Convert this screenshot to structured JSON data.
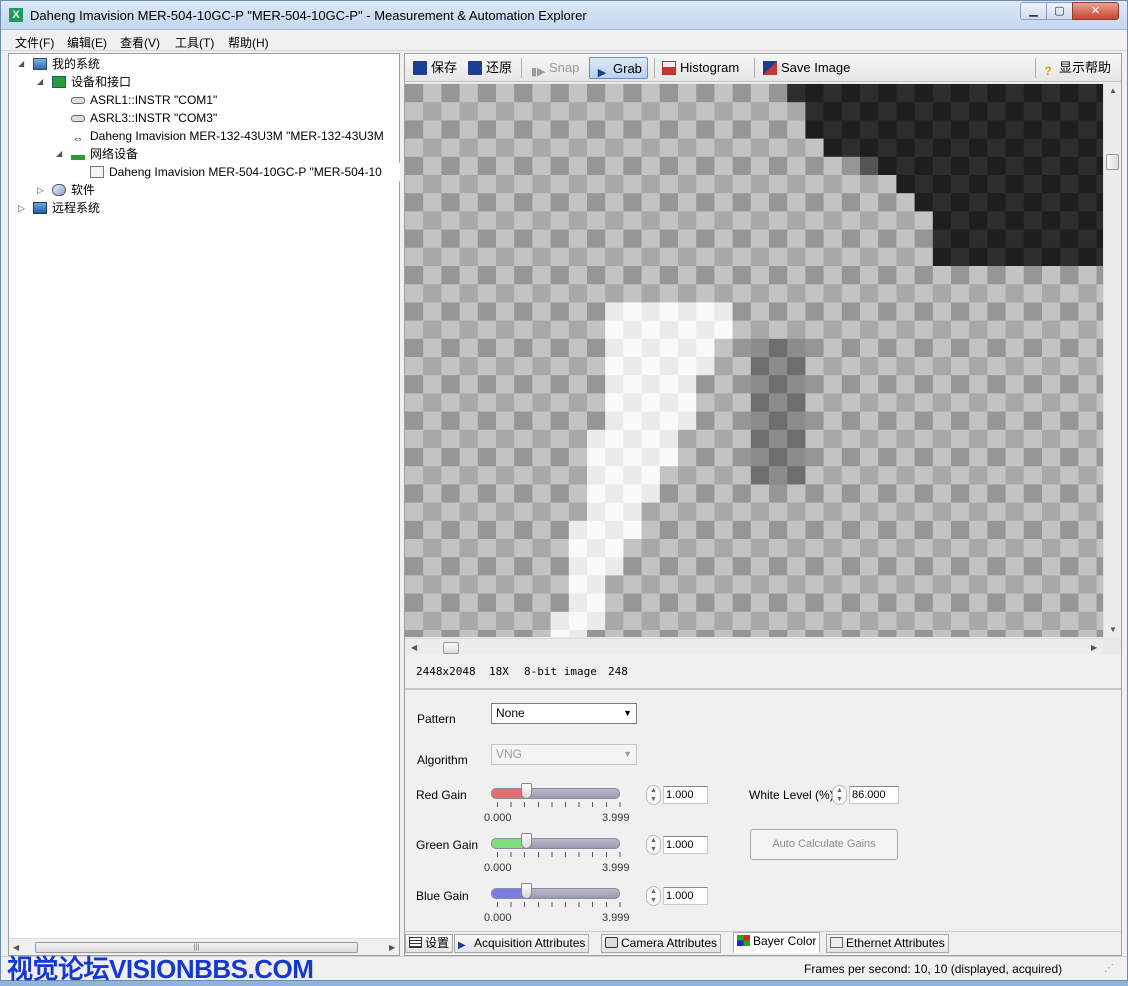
{
  "window": {
    "title": "Daheng Imavision MER-504-10GC-P \"MER-504-10GC-P\" - Measurement & Automation Explorer",
    "app_icon": "X",
    "controls": {
      "minimize": "▁",
      "maximize": "▢",
      "close": "✕"
    }
  },
  "menu": [
    "文件(F)",
    "编辑(E)",
    "查看(V)",
    "工具(T)",
    "帮助(H)"
  ],
  "tree": {
    "my_system": "我的系统",
    "devices_interfaces": "设备和接口",
    "asrl1": "ASRL1::INSTR \"COM1\"",
    "asrl3": "ASRL3::INSTR \"COM3\"",
    "usb_camera": "Daheng Imavision MER-132-43U3M \"MER-132-43U3M",
    "network_devices": "网络设备",
    "gige_camera": "Daheng Imavision MER-504-10GC-P \"MER-504-10",
    "software": "软件",
    "remote_systems": "远程系统"
  },
  "toolbar": {
    "save": "保存",
    "revert": "还原",
    "snap": "Snap",
    "grab": "Grab",
    "histogram": "Histogram",
    "save_image": "Save Image",
    "show_help": "显示帮助"
  },
  "image_status": {
    "resolution": "2448x2048",
    "zoom": "18X",
    "bit_depth": "8-bit image",
    "pixel_value": "248"
  },
  "bayer": {
    "pattern_label": "Pattern",
    "pattern_value": "None",
    "algorithm_label": "Algorithm",
    "algorithm_value": "VNG",
    "red_gain_label": "Red Gain",
    "red_gain_value": "1.000",
    "green_gain_label": "Green Gain",
    "green_gain_value": "1.000",
    "blue_gain_label": "Blue Gain",
    "blue_gain_value": "1.000",
    "slider_min": "0.000",
    "slider_max": "3.999",
    "gain_level_fraction": 0.25,
    "white_level_label": "White Level (%)",
    "white_level_value": "86.000",
    "auto_calc": "Auto Calculate Gains",
    "colors": {
      "red": "#e07070",
      "green": "#7ee07e",
      "blue": "#7b7be0"
    }
  },
  "tabs": [
    "设置",
    "Acquisition Attributes",
    "Camera Attributes",
    "Bayer Color",
    "Ethernet Attributes"
  ],
  "statusbar": {
    "watermark": "视觉论坛VISIONBBS.COM",
    "fps": "Frames per second: 10, 10 (displayed, acquired)"
  }
}
